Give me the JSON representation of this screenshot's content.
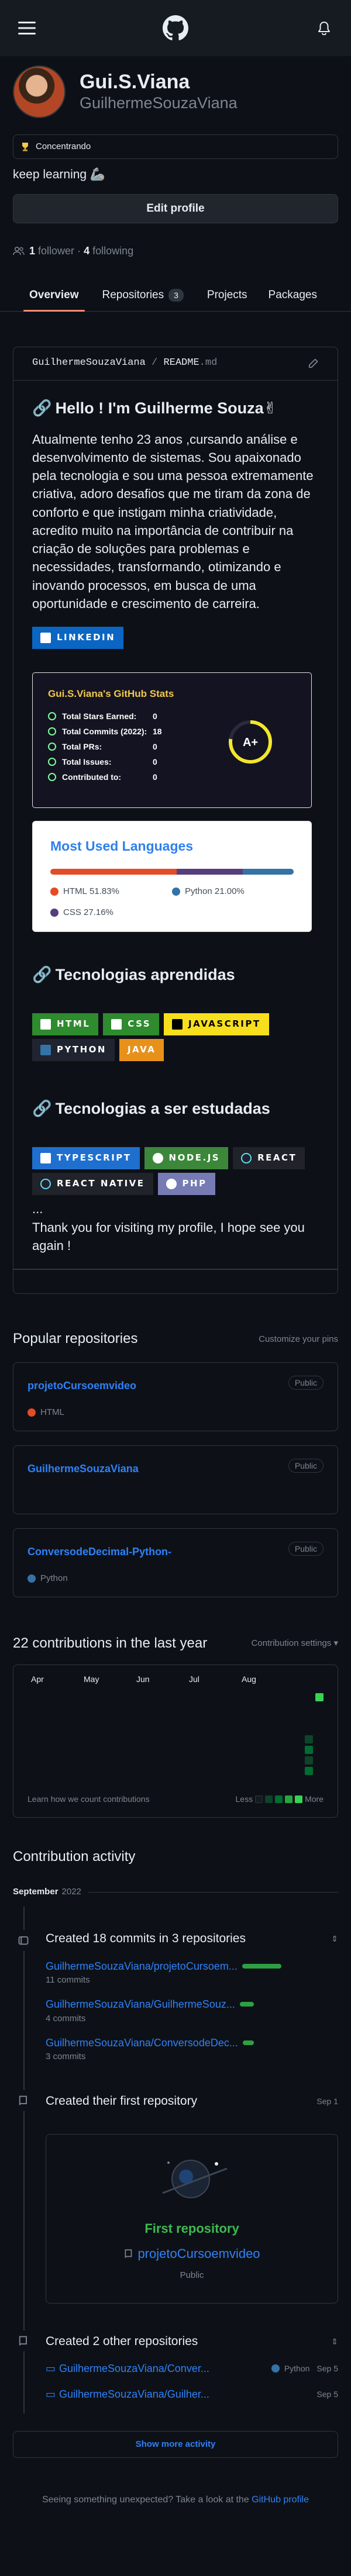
{
  "profile": {
    "name": "Gui.S.Viana",
    "login": "GuilhermeSouzaViana",
    "status": "Concentrando",
    "bio": "keep learning 🦾",
    "edit_label": "Edit profile",
    "followers_count": "1",
    "followers_label": "follower",
    "following_count": "4",
    "following_label": "following"
  },
  "tabs": [
    {
      "label": "Overview"
    },
    {
      "label": "Repositories",
      "count": "3"
    },
    {
      "label": "Projects"
    },
    {
      "label": "Packages"
    }
  ],
  "readme": {
    "path_user": "GuilhermeSouzaViana",
    "path_sep": " / ",
    "path_file": "README",
    "path_ext": ".md",
    "greeting": "Hello ! I'm Guilherme Souza✌",
    "intro": "Atualmente tenho 23 anos ,cursando análise e desenvolvimento de sistemas. Sou apaixonado pela tecnologia e sou uma pessoa extremamente criativa, adoro desafios que me tiram da zona de conforto e que instigam minha criatividade, acredito muito na importância de contribuir na criação de soluções para problemas e necessidades, transformando, otimizando e inovando processos, em busca de uma oportunidade e crescimento de carreira.",
    "linkedin_badge": "LINKEDIN",
    "learned_title": "Tecnologias aprendidas",
    "learned_badges": [
      "HTML",
      "CSS",
      "JAVASCRIPT",
      "PYTHON",
      "JAVA"
    ],
    "studying_title": "Tecnologias a ser estudadas",
    "studying_badges": [
      "TYPESCRIPT",
      "NODE.JS",
      "REACT",
      "REACT NATIVE",
      "PHP"
    ],
    "ellipsis": "...",
    "thanks": "Thank you for visiting my profile, I hope see you again !"
  },
  "stats_card": {
    "title": "Gui.S.Viana's GitHub Stats",
    "rows": [
      {
        "label": "Total Stars Earned:",
        "value": "0"
      },
      {
        "label": "Total Commits (2022):",
        "value": "18"
      },
      {
        "label": "Total PRs:",
        "value": "0"
      },
      {
        "label": "Total Issues:",
        "value": "0"
      },
      {
        "label": "Contributed to:",
        "value": "0"
      }
    ],
    "grade": "A+"
  },
  "langs_card": {
    "title": "Most Used Languages",
    "items": [
      {
        "name": "HTML",
        "percent": "51.83%",
        "value": 51.83,
        "color": "#e34c26"
      },
      {
        "name": "Python",
        "percent": "21.00%",
        "value": 21.0,
        "color": "#3572A5"
      },
      {
        "name": "CSS",
        "percent": "27.16%",
        "value": 27.16,
        "color": "#563d7c"
      }
    ]
  },
  "popular": {
    "title": "Popular repositories",
    "customize": "Customize your pins",
    "repos": [
      {
        "name": "projetoCursoemvideo",
        "visibility": "Public",
        "language": "HTML",
        "lang_color": "#e34c26"
      },
      {
        "name": "GuilhermeSouzaViana",
        "visibility": "Public",
        "language": "",
        "lang_color": ""
      },
      {
        "name": "ConversodeDecimal-Python-",
        "visibility": "Public",
        "language": "Python",
        "lang_color": "#3572A5"
      }
    ]
  },
  "contributions": {
    "title": "22 contributions in the last year",
    "settings": "Contribution settings ▾",
    "months": [
      "Apr",
      "May",
      "Jun",
      "Jul",
      "Aug"
    ],
    "learn": "Learn how we count contributions",
    "less": "Less",
    "more": "More"
  },
  "activity": {
    "title": "Contribution activity",
    "month": "September",
    "year": "2022",
    "commits_title": "Created 18 commits in 3 repositories",
    "commit_repos": [
      {
        "name": "GuilhermeSouzaViana/projetoCursoem...",
        "count": "11 commits",
        "share": 0.61
      },
      {
        "name": "GuilhermeSouzaViana/GuilhermeSouz...",
        "count": "4 commits",
        "share": 0.22
      },
      {
        "name": "GuilhermeSouzaViana/ConversodeDec...",
        "count": "3 commits",
        "share": 0.17
      }
    ],
    "first_title": "Created their first repository",
    "first_date": "Sep 1",
    "first_card_title": "First repository",
    "first_card_repo": "projetoCursoemvideo",
    "first_card_visibility": "Public",
    "other_title": "Created 2 other repositories",
    "other_repos": [
      {
        "name": "GuilhermeSouzaViana/Conver...",
        "lang": "Python",
        "date": "Sep 5"
      },
      {
        "name": "GuilhermeSouzaViana/Guilher...",
        "lang": "",
        "date": "Sep 5"
      }
    ],
    "more_btn": "Show more activity"
  },
  "footer": {
    "text": "Seeing something unexpected? Take a look at the ",
    "link": "GitHub profile"
  }
}
